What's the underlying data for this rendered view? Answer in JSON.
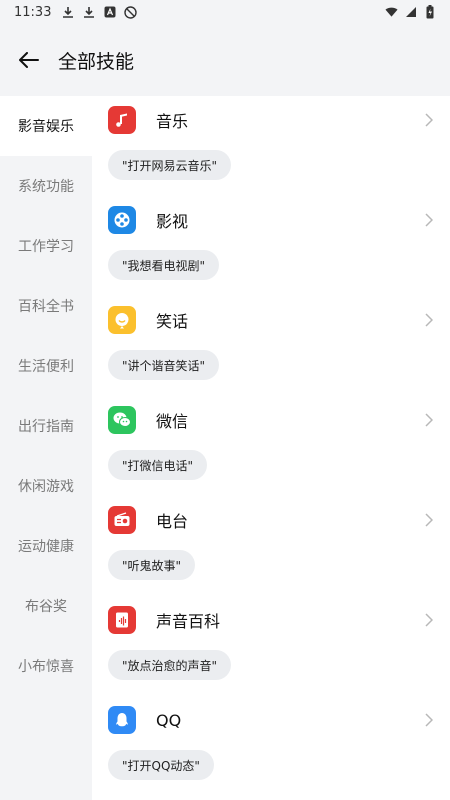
{
  "status": {
    "time": "11:33"
  },
  "header": {
    "title": "全部技能"
  },
  "sidebar": {
    "items": [
      {
        "label": "影音娱乐",
        "active": true
      },
      {
        "label": "系统功能"
      },
      {
        "label": "工作学习"
      },
      {
        "label": "百科全书"
      },
      {
        "label": "生活便利"
      },
      {
        "label": "出行指南"
      },
      {
        "label": "休闲游戏"
      },
      {
        "label": "运动健康"
      },
      {
        "label": "布谷奖"
      },
      {
        "label": "小布惊喜"
      }
    ]
  },
  "skills": [
    {
      "name": "音乐",
      "example": "\"打开网易云音乐\"",
      "icon": "music-note-icon",
      "color": "#e53935"
    },
    {
      "name": "影视",
      "example": "\"我想看电视剧\"",
      "icon": "film-reel-icon",
      "color": "#1e88e5"
    },
    {
      "name": "笑话",
      "example": "\"讲个谐音笑话\"",
      "icon": "smile-bubble-icon",
      "color": "#fbc02d"
    },
    {
      "name": "微信",
      "example": "\"打微信电话\"",
      "icon": "wechat-icon",
      "color": "#2dc55e"
    },
    {
      "name": "电台",
      "example": "\"听鬼故事\"",
      "icon": "radio-icon",
      "color": "#e53935"
    },
    {
      "name": "声音百科",
      "example": "\"放点治愈的声音\"",
      "icon": "sound-book-icon",
      "color": "#e53935"
    },
    {
      "name": "QQ",
      "example": "\"打开QQ动态\"",
      "icon": "qq-penguin-icon",
      "color": "#2f8af5"
    }
  ]
}
